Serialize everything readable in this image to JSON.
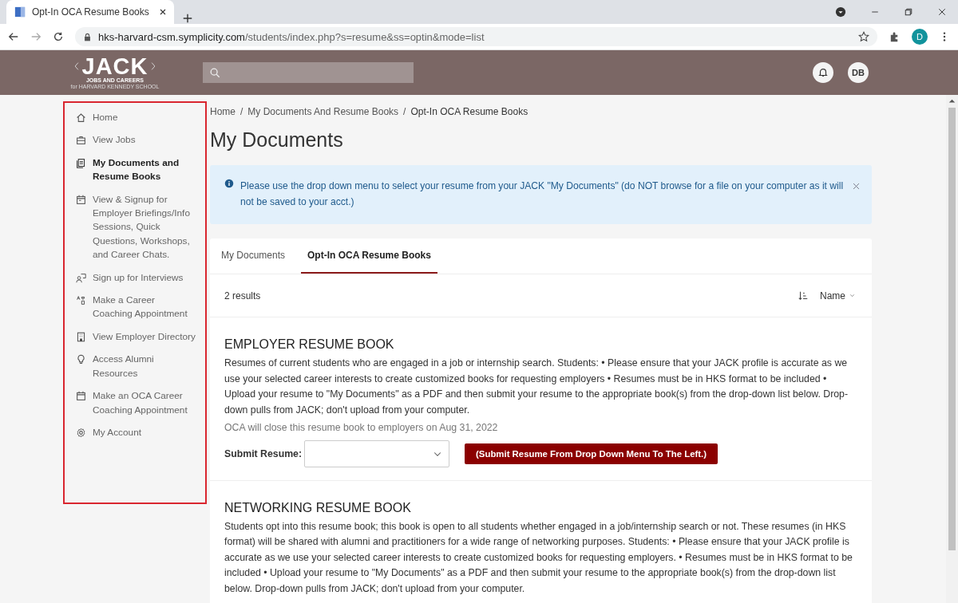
{
  "browser": {
    "tab_title": "Opt-In OCA Resume Books",
    "url_host": "hks-harvard-csm.symplicity.com",
    "url_path": "/students/index.php?s=resume&ss=optin&mode=list",
    "profile_initial": "D"
  },
  "header": {
    "logo_text": "JACK",
    "logo_subtitle": "JOBS AND CAREERS",
    "logo_tagline": "for HARVARD KENNEDY SCHOOL",
    "avatar": "DB"
  },
  "sidebar": {
    "items": [
      {
        "label": "Home",
        "selected": false
      },
      {
        "label": "View Jobs",
        "selected": false
      },
      {
        "label": "My Documents and Resume Books",
        "selected": true
      },
      {
        "label": "View & Signup for Employer Briefings/Info Sessions, Quick Questions, Workshops, and Career Chats.",
        "selected": false
      },
      {
        "label": "Sign up for Interviews",
        "selected": false
      },
      {
        "label": "Make a Career Coaching Appointment",
        "selected": false
      },
      {
        "label": "View Employer Directory",
        "selected": false
      },
      {
        "label": "Access Alumni Resources",
        "selected": false
      },
      {
        "label": "Make an OCA Career Coaching Appointment",
        "selected": false
      },
      {
        "label": "My Account",
        "selected": false
      }
    ]
  },
  "breadcrumbs": [
    "Home",
    "My Documents And Resume Books",
    "Opt-In OCA Resume Books"
  ],
  "breadcrumb_separator": "/",
  "page_title": "My Documents",
  "alert": {
    "text": "Please use the drop down menu to select your resume from your JACK \"My Documents\" (do NOT browse for a file on your computer as it will not be saved to your acct.)"
  },
  "tabs": [
    {
      "label": "My Documents",
      "selected": false
    },
    {
      "label": "Opt-In OCA Resume Books",
      "selected": true
    }
  ],
  "results_count": "2 results",
  "sort_label": "Name",
  "books": [
    {
      "title": "EMPLOYER RESUME BOOK",
      "description": "Resumes of current students who are engaged in a job or internship search. Students: • Please ensure that your JACK profile is accurate as we use your selected career interests to create customized books for requesting employers • Resumes must be in HKS format to be included • Upload your resume to \"My Documents\" as a PDF and then submit your resume to the appropriate book(s) from the drop-down list below. Drop-down pulls from JACK; don't upload from your computer.",
      "closing_note": "OCA will close this resume book to employers on Aug 31, 2022",
      "submit_label": "Submit Resume:",
      "submit_button": "(Submit Resume From Drop Down Menu To The Left.)"
    },
    {
      "title": "NETWORKING RESUME BOOK",
      "description": "Students opt into this resume book; this book is open to all students whether engaged in a job/internship search or not. These resumes (in HKS format) will be shared with alumni and practitioners for a wide range of networking purposes. Students: • Please ensure that your JACK profile is accurate as we use your selected career interests to create customized books for requesting employers. • Resumes must be in HKS format to be included • Upload your resume to \"My Documents\" as a PDF and then submit your resume to the appropriate book(s) from the drop-down list below. Drop-down pulls from JACK; don't upload from your computer."
    }
  ]
}
